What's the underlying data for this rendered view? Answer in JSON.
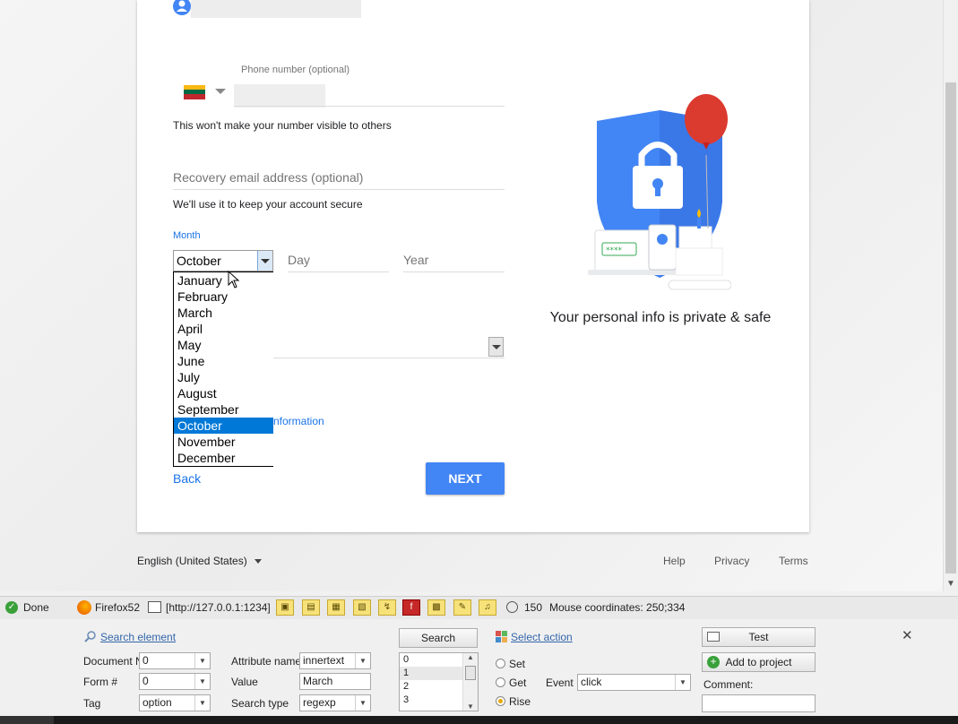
{
  "form": {
    "phone_label": "Phone number (optional)",
    "phone_helper": "This won't make your number visible to others",
    "recovery_placeholder": "Recovery email address (optional)",
    "recovery_helper": "We'll use it to keep your account secure",
    "month_label": "Month",
    "month_value": "October",
    "day_placeholder": "Day",
    "year_placeholder": "Year",
    "months": [
      "January",
      "February",
      "March",
      "April",
      "May",
      "June",
      "July",
      "August",
      "September",
      "October",
      "November",
      "December"
    ],
    "selected_month_index": 9,
    "info_link_fragment": "nformation",
    "back_label": "Back",
    "next_label": "NEXT"
  },
  "illustration": {
    "caption": "Your personal info is private & safe",
    "password_mask": "****"
  },
  "footer": {
    "language": "English (United States)",
    "links": [
      "Help",
      "Privacy",
      "Terms"
    ]
  },
  "statusbar": {
    "status": "Done",
    "browser": "Firefox52",
    "url": "[http://127.0.0.1:1234]",
    "timer": "150",
    "mouse": "Mouse coordinates: 250;334"
  },
  "panel": {
    "search_element_link": "Search element",
    "document_label": "Document N",
    "document_value": "0",
    "form_label": "Form #",
    "form_value": "0",
    "tag_label": "Tag",
    "tag_value": "option",
    "attr_name_label": "Attribute name",
    "attr_name_value": "innertext",
    "value_label": "Value",
    "value_value": "March",
    "search_type_label": "Search type",
    "search_type_value": "regexp",
    "search_button": "Search",
    "results": [
      "0",
      "1",
      "2",
      "3"
    ],
    "select_action_link": "Select action",
    "radio_set": "Set",
    "radio_get": "Get",
    "radio_rise": "Rise",
    "event_label": "Event",
    "event_value": "click",
    "test_button": "Test",
    "add_button": "Add to project",
    "comment_label": "Comment:"
  },
  "colors": {
    "google_blue": "#4285f4",
    "link_blue": "#1a73e8",
    "selection": "#0078d7",
    "balloon": "#db3a2f"
  }
}
